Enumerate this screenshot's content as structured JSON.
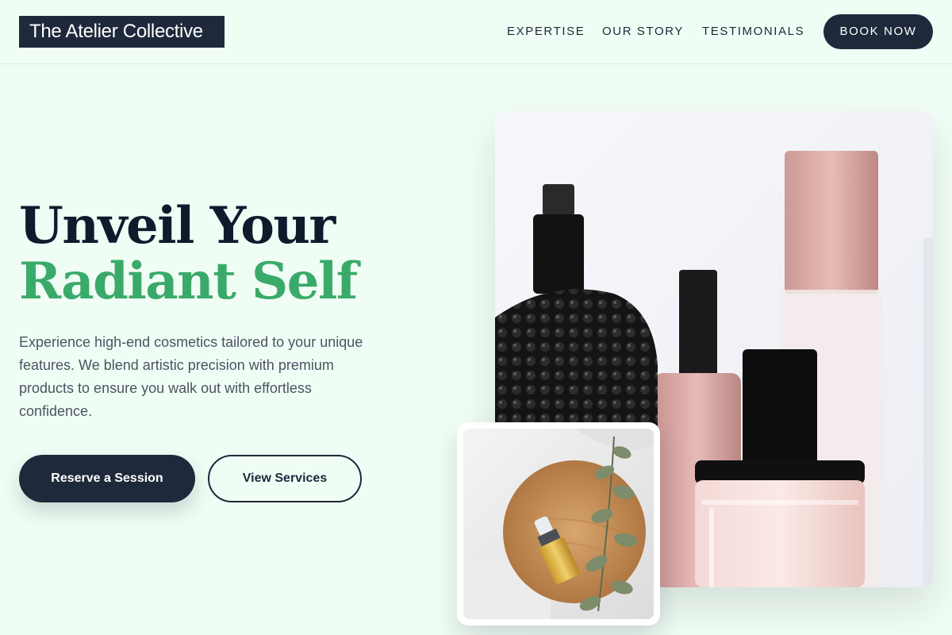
{
  "header": {
    "logo": "The Atelier Collective",
    "nav": [
      {
        "label": "EXPERTISE"
      },
      {
        "label": "OUR STORY"
      },
      {
        "label": "TESTIMONIALS"
      }
    ],
    "cta_label": "BOOK NOW"
  },
  "hero": {
    "headline_line1": "Unveil Your",
    "headline_line2": "Radiant Self",
    "description": "Experience high-end cosmetics tailored to your unique features. We blend artistic precision with premium products to ensure you walk out with effortless confidence.",
    "primary_cta": "Reserve a Session",
    "secondary_cta": "View Services"
  },
  "colors": {
    "background": "#f0fdf4",
    "navy": "#1e293b",
    "accent_green": "#3aaa6a",
    "body_text": "#4b5563"
  },
  "images": {
    "hero": "perfume-bottles-photo",
    "detail": "serum-dropper-bottle-photo"
  }
}
